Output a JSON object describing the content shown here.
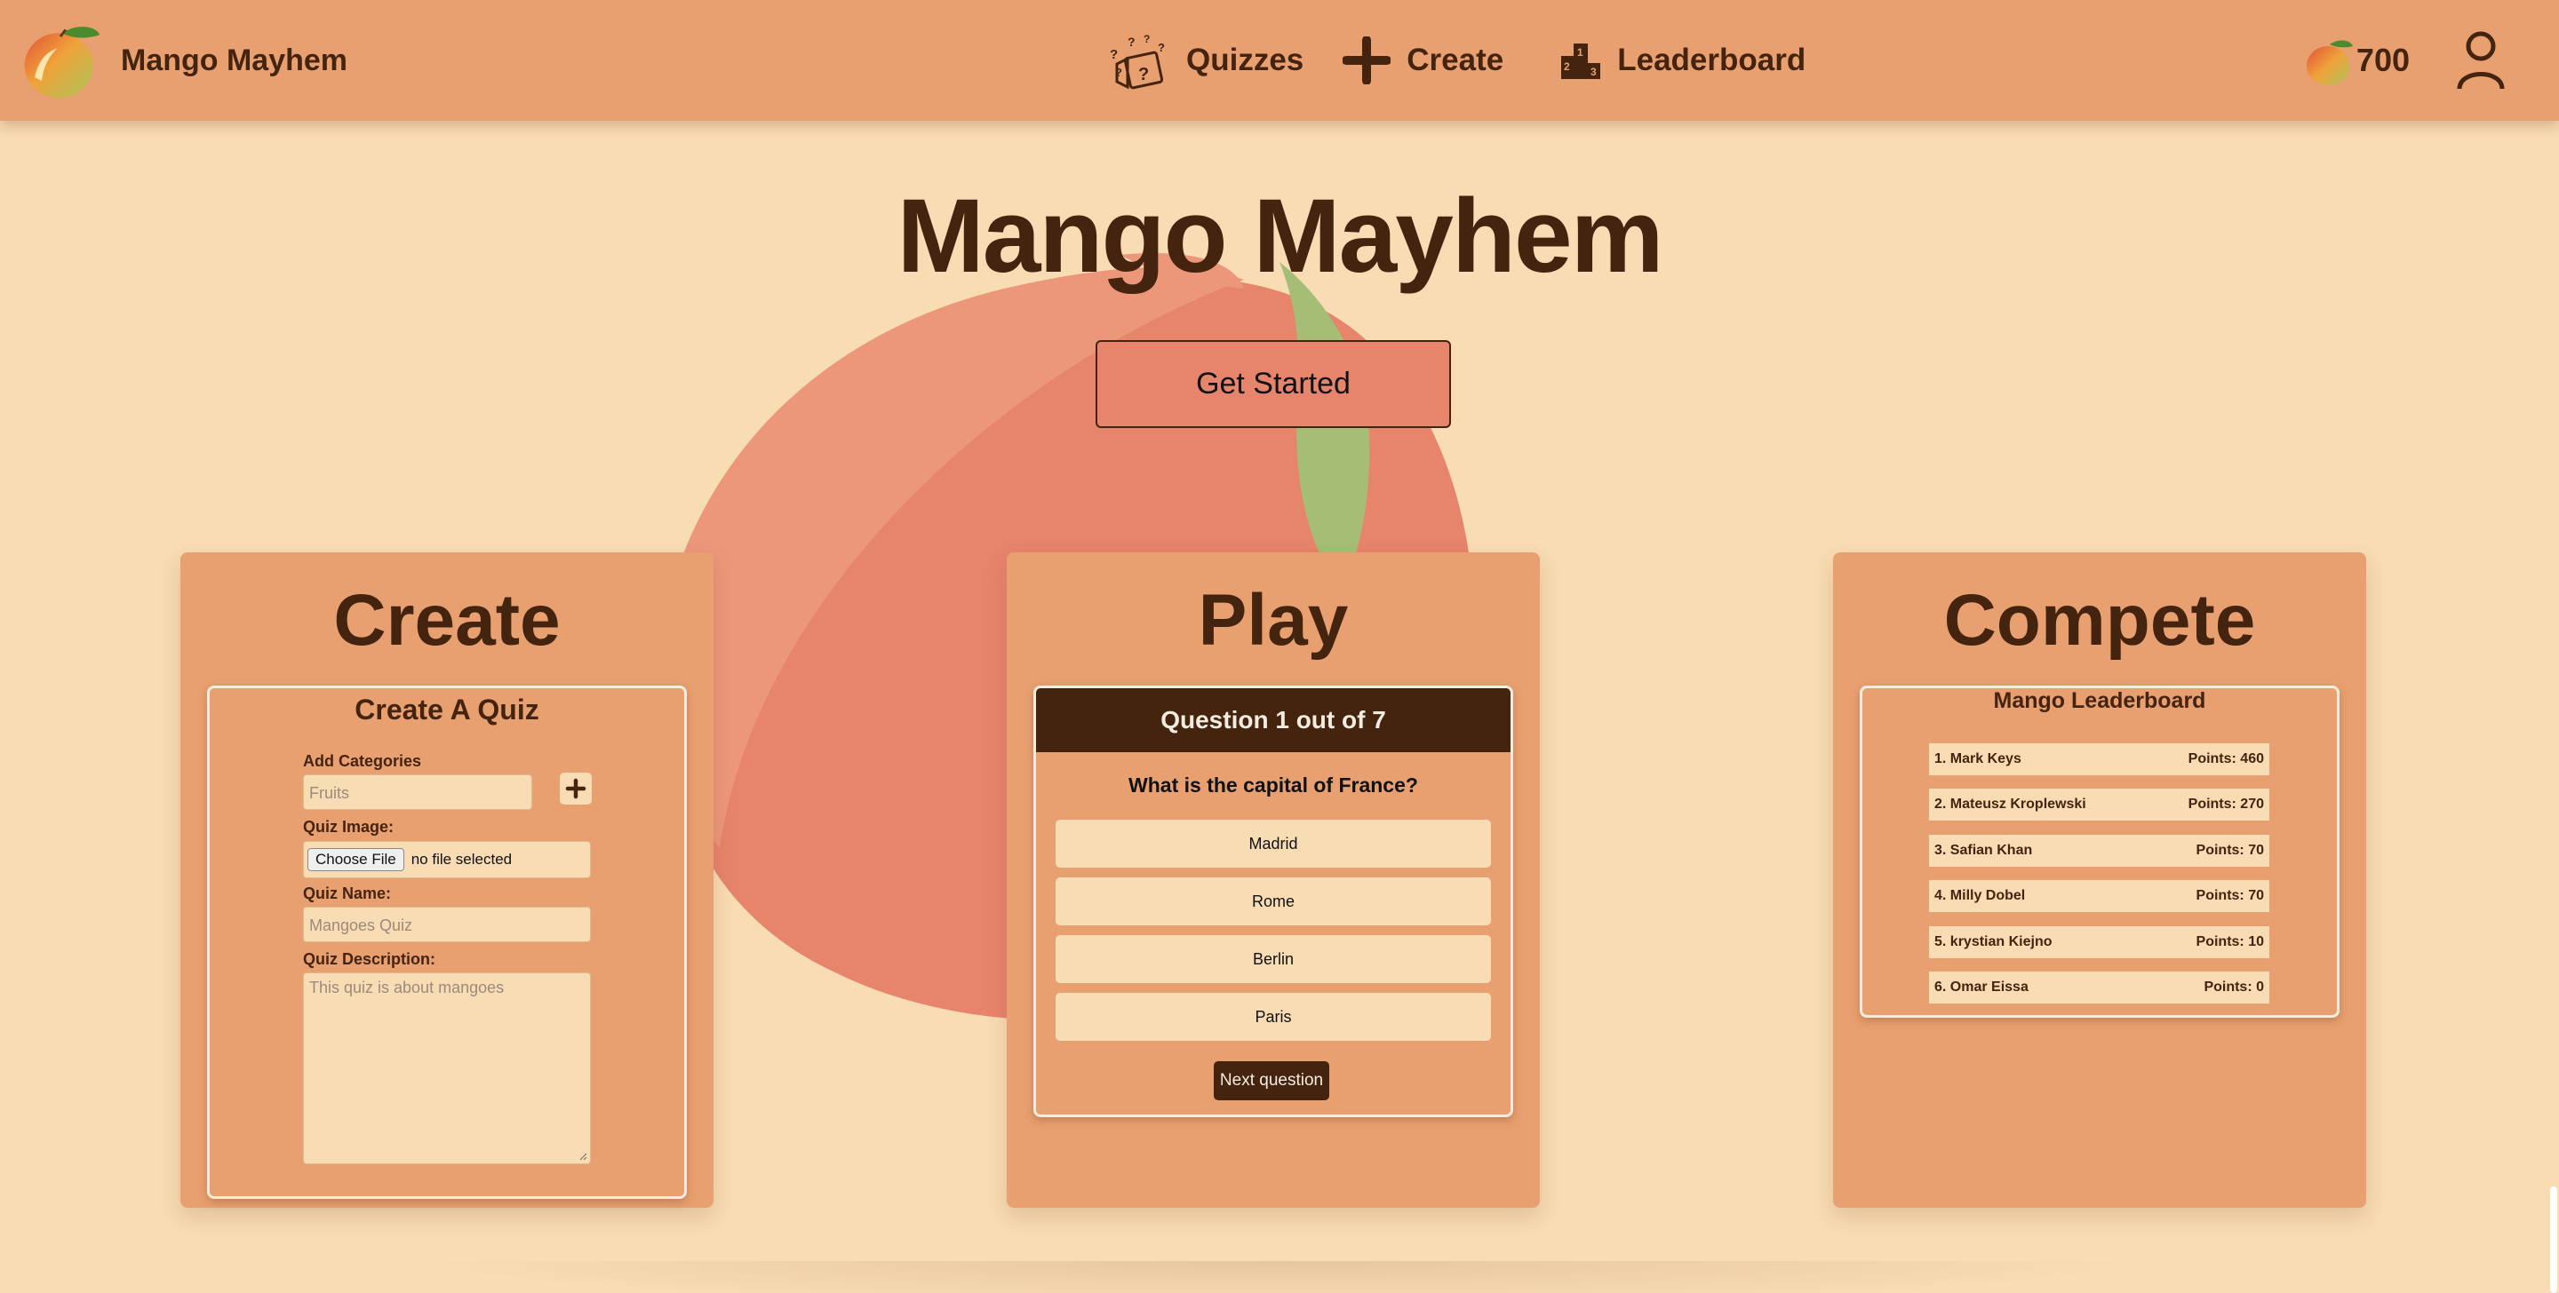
{
  "colors": {
    "background": "#f8dcb4",
    "navbar": "#e9a070",
    "card": "#e9a070",
    "dark_brown": "#45240f",
    "mango_red": "#e7846c",
    "mango_green": "#a5bd74"
  },
  "navbar": {
    "brand_name": "Mango Mayhem",
    "logo_icon": "mango-logo-icon",
    "links": [
      {
        "label": "Quizzes",
        "icon": "quiz-dice-icon"
      },
      {
        "label": "Create",
        "icon": "plus-icon"
      },
      {
        "label": "Leaderboard",
        "icon": "podium-icon"
      }
    ],
    "coins": "700",
    "coin_icon": "mango-coin-icon",
    "profile_icon": "user-icon"
  },
  "hero": {
    "title": "Mango Mayhem",
    "cta_label": "Get Started"
  },
  "cards": {
    "create": {
      "title": "Create",
      "form_title": "Create A Quiz",
      "categories_label": "Add Categories",
      "categories_placeholder": "Fruits",
      "image_label": "Quiz Image:",
      "file_button": "Choose File",
      "file_status": "no file selected",
      "name_label": "Quiz Name:",
      "name_placeholder": "Mangoes Quiz",
      "description_label": "Quiz Description:",
      "description_placeholder": "This quiz is about mangoes"
    },
    "play": {
      "title": "Play",
      "question_header": "Question 1 out of 7",
      "question": "What is the capital of France?",
      "answers": [
        "Madrid",
        "Rome",
        "Berlin",
        "Paris"
      ],
      "next_label": "Next question"
    },
    "compete": {
      "title": "Compete",
      "leaderboard_title": "Mango Leaderboard",
      "rows": [
        {
          "name": "1. Mark Keys",
          "points": "Points: 460"
        },
        {
          "name": "2. Mateusz Kroplewski",
          "points": "Points: 270"
        },
        {
          "name": "3. Safian Khan",
          "points": "Points: 70"
        },
        {
          "name": "4. Milly Dobel",
          "points": "Points: 70"
        },
        {
          "name": "5. krystian Kiejno",
          "points": "Points: 10"
        },
        {
          "name": "6. Omar Eissa",
          "points": "Points: 0"
        }
      ]
    }
  }
}
